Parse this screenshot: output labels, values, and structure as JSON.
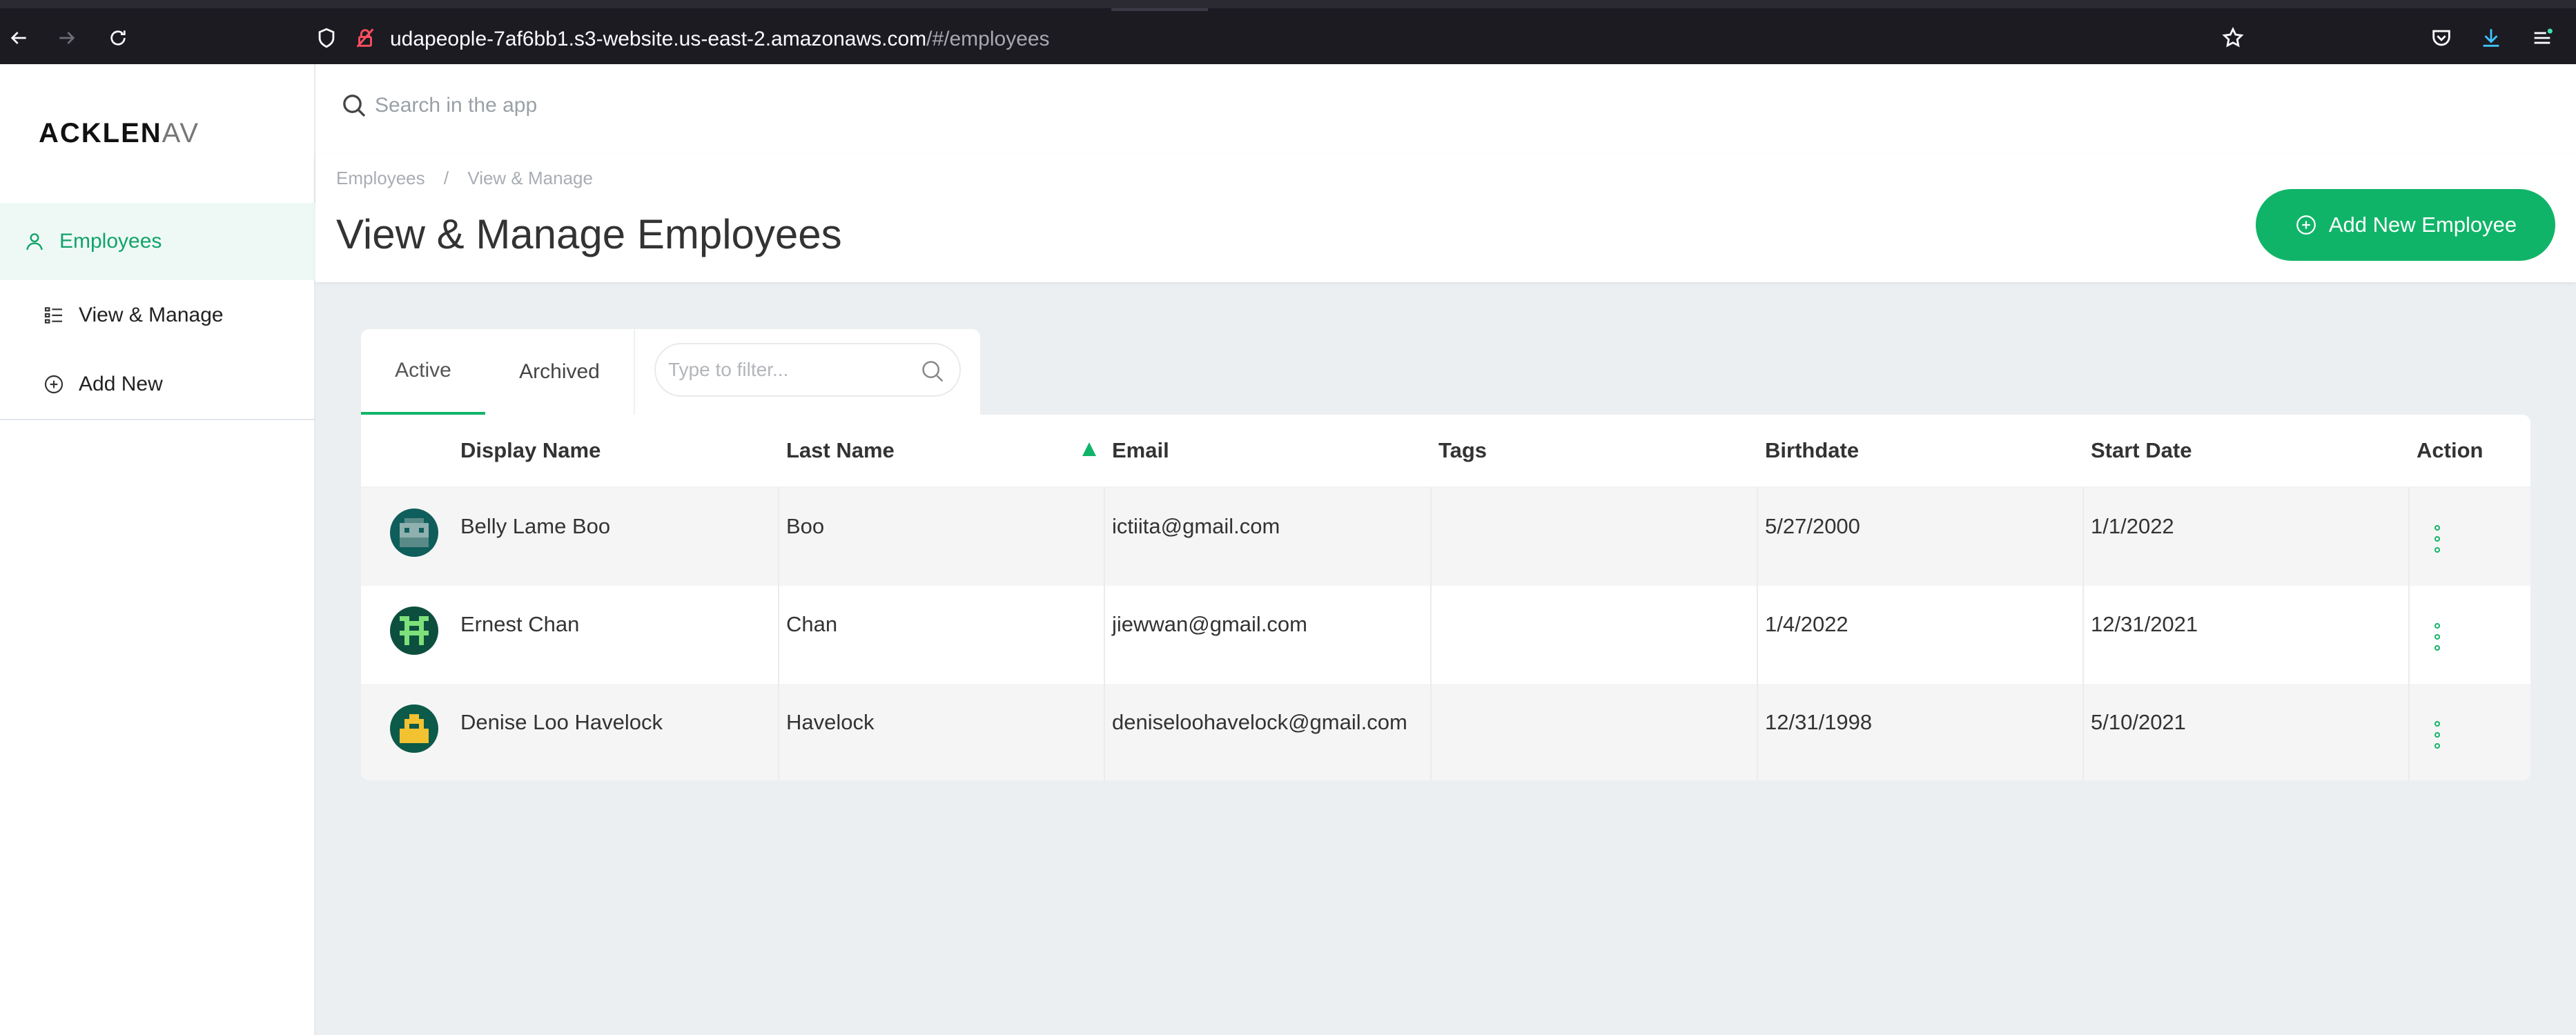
{
  "browser": {
    "url_main": "udapeople-7af6bb1.s3-website.us-east-2.amazonaws.com",
    "url_path": "/#/employees"
  },
  "sidebar": {
    "logo_main": "ACKLEN",
    "logo_fade": "AV",
    "items": [
      {
        "label": "Employees",
        "icon": "person-icon"
      },
      {
        "label": "View & Manage",
        "icon": "list-icon"
      },
      {
        "label": "Add New",
        "icon": "plus-circle-icon"
      }
    ]
  },
  "topbar": {
    "search_placeholder": "Search in the app"
  },
  "header": {
    "breadcrumb": [
      "Employees",
      "/",
      "View & Manage"
    ],
    "title": "View & Manage Employees",
    "add_button": "Add New Employee"
  },
  "tabs": {
    "active": "Active",
    "archived": "Archived",
    "filter_placeholder": "Type to filter..."
  },
  "table": {
    "columns": [
      "Display Name",
      "Last Name",
      "Email",
      "Tags",
      "Birthdate",
      "Start Date",
      "Action"
    ],
    "rows": [
      {
        "display_name": "Belly Lame Boo",
        "last_name": "Boo",
        "email": "ictiita@gmail.com",
        "tags": "",
        "birthdate": "5/27/2000",
        "start_date": "1/1/2022",
        "avatar_color": "#0f5e5b"
      },
      {
        "display_name": "Ernest Chan",
        "last_name": "Chan",
        "email": "jiewwan@gmail.com",
        "tags": "",
        "birthdate": "1/4/2022",
        "start_date": "12/31/2021",
        "avatar_color": "#0d4f3f"
      },
      {
        "display_name": "Denise Loo Havelock",
        "last_name": "Havelock",
        "email": "deniseloohavelock@gmail.com",
        "tags": "",
        "birthdate": "12/31/1998",
        "start_date": "5/10/2021",
        "avatar_color": "#0c5a4a"
      }
    ]
  },
  "colors": {
    "accent": "#10b468",
    "sidebar_active_bg": "#eef9f6",
    "main_bg": "#eceff2"
  }
}
